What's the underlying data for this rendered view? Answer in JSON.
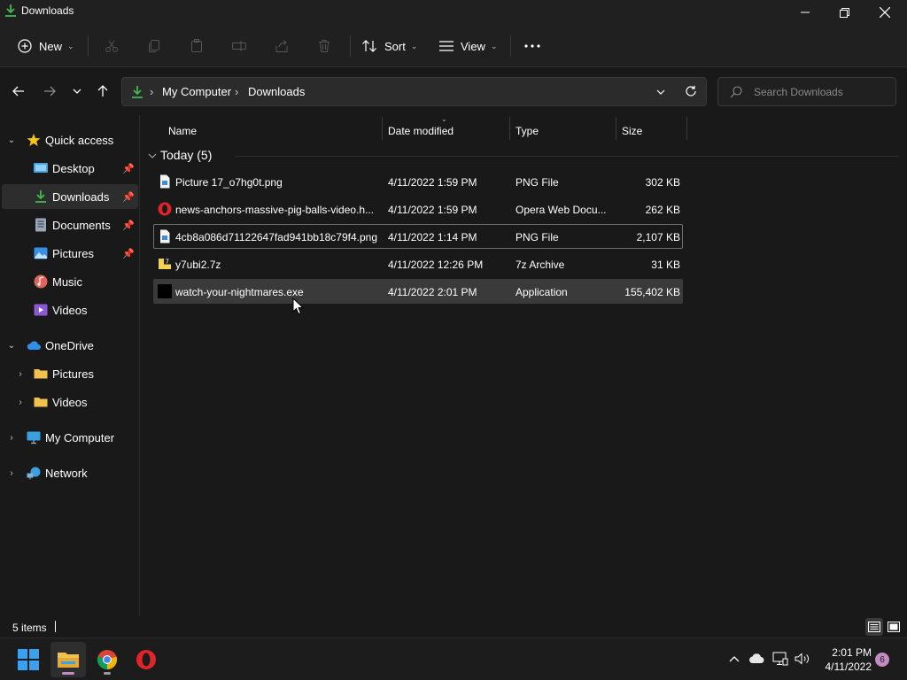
{
  "window": {
    "title": "Downloads",
    "icon": "download-arrow-icon"
  },
  "toolbar": {
    "new_label": "New",
    "sort_label": "Sort",
    "view_label": "View",
    "more_label": "..."
  },
  "address": {
    "crumbs": [
      "My Computer",
      "Downloads"
    ],
    "search_placeholder": "Search Downloads"
  },
  "sidebar": {
    "items": [
      {
        "label": "Quick access",
        "icon": "star-icon"
      },
      {
        "label": "Desktop",
        "icon": "desktop-icon"
      },
      {
        "label": "Downloads",
        "icon": "download-icon"
      },
      {
        "label": "Documents",
        "icon": "documents-icon"
      },
      {
        "label": "Pictures",
        "icon": "pictures-icon"
      },
      {
        "label": "Music",
        "icon": "music-icon"
      },
      {
        "label": "Videos",
        "icon": "videos-icon"
      },
      {
        "label": "OneDrive",
        "icon": "cloud-icon"
      },
      {
        "label": "Pictures",
        "icon": "folder-icon"
      },
      {
        "label": "Videos",
        "icon": "folder-icon"
      },
      {
        "label": "My Computer",
        "icon": "computer-icon"
      },
      {
        "label": "Network",
        "icon": "network-icon"
      }
    ]
  },
  "columns": {
    "name": "Name",
    "date": "Date modified",
    "type": "Type",
    "size": "Size"
  },
  "group": {
    "label": "Today (5)"
  },
  "files": [
    {
      "name": "Picture 17_o7hg0t.png",
      "date": "4/11/2022 1:59 PM",
      "type": "PNG File",
      "size": "302 KB",
      "icon": "image-file-icon"
    },
    {
      "name": "news-anchors-massive-pig-balls-video.h...",
      "date": "4/11/2022 1:59 PM",
      "type": "Opera Web Docu...",
      "size": "262 KB",
      "icon": "opera-icon"
    },
    {
      "name": "4cb8a086d71122647fad941bb18c79f4.png",
      "date": "4/11/2022 1:14 PM",
      "type": "PNG File",
      "size": "2,107 KB",
      "icon": "image-file-icon"
    },
    {
      "name": "y7ubi2.7z",
      "date": "4/11/2022 12:26 PM",
      "type": "7z Archive",
      "size": "31 KB",
      "icon": "archive-icon"
    },
    {
      "name": "watch-your-nightmares.exe",
      "date": "4/11/2022 2:01 PM",
      "type": "Application",
      "size": "155,402 KB",
      "icon": "application-icon"
    }
  ],
  "status": {
    "items_count": "5 items"
  },
  "taskbar": {
    "time": "2:01 PM",
    "date": "4/11/2022",
    "notification_count": "6"
  },
  "colors": {
    "accent_green": "#3fb950",
    "selection": "#2d2d2d",
    "hover": "#3a3a3a",
    "badge": "#c48ac5"
  }
}
